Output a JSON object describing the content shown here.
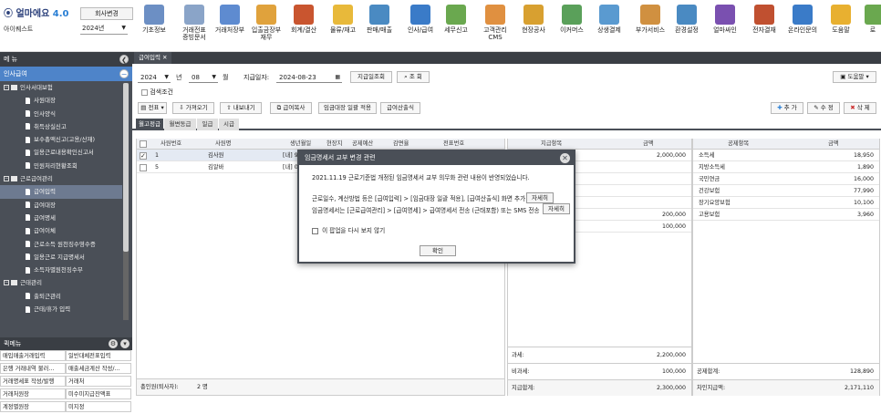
{
  "app": {
    "logo": "얼마에요",
    "version": "4.0",
    "company": "아이퀘스트",
    "switch_label": "회사변경",
    "year": "2024년"
  },
  "top_menu": [
    {
      "label": "기초정보",
      "icon": "document-icon",
      "color": "#6c8fc4"
    },
    {
      "label": "거래전표",
      "label2": "증빙문서",
      "icon": "ledger-icon",
      "color": "#8aa4c8"
    },
    {
      "label": "거래처장부",
      "icon": "book-icon",
      "color": "#5e8bd0"
    },
    {
      "label": "입출금장부",
      "label2": "재무",
      "icon": "house-icon",
      "color": "#e0a23c"
    },
    {
      "label": "회계/결산",
      "icon": "calc-icon",
      "color": "#c9552f"
    },
    {
      "label": "물류/재고",
      "icon": "truck-icon",
      "color": "#e8b93a"
    },
    {
      "label": "판매/매출",
      "icon": "cart-icon",
      "color": "#4a8ac2"
    },
    {
      "label": "인사/급여",
      "icon": "person-icon",
      "color": "#3a7bc8"
    },
    {
      "label": "세무신고",
      "icon": "tax-icon",
      "color": "#6aa84f"
    },
    {
      "label": "고객관리",
      "label2": "CMS",
      "icon": "people-icon",
      "color": "#e09040"
    },
    {
      "label": "현장공사",
      "icon": "construction-icon",
      "color": "#d8a030"
    },
    {
      "label": "이커머스",
      "icon": "shop-icon",
      "color": "#5aa05a"
    },
    {
      "label": "상생결제",
      "icon": "card-icon",
      "color": "#5a9ad0"
    },
    {
      "label": "부가서비스",
      "icon": "bank-icon",
      "color": "#d09040"
    },
    {
      "label": "환경설정",
      "icon": "gear-icon",
      "color": "#4a8ac2"
    },
    {
      "label": "얼마싸인",
      "icon": "sign-icon",
      "color": "#7a50b0"
    },
    {
      "label": "전자결재",
      "icon": "approval-icon",
      "color": "#c05030"
    },
    {
      "label": "온라인문의",
      "icon": "chat-icon",
      "color": "#3a7bc8"
    },
    {
      "label": "도움말",
      "icon": "help-icon",
      "color": "#e8b030"
    },
    {
      "label": "로",
      "icon": "logout-icon",
      "color": "#6aa84f"
    }
  ],
  "sidebar": {
    "header": "메 뉴",
    "section": "인사급여",
    "tree": [
      {
        "label": "인사서대보험",
        "type": "folder"
      },
      {
        "label": "사원대장",
        "type": "leaf"
      },
      {
        "label": "인사양식",
        "type": "leaf"
      },
      {
        "label": "취득상실신고",
        "type": "leaf"
      },
      {
        "label": "보수총액신고(고용/산재)",
        "type": "leaf"
      },
      {
        "label": "일용근로내용확인신고서",
        "type": "leaf"
      },
      {
        "label": "민원처리현황조회",
        "type": "leaf"
      },
      {
        "label": "근로급여관리",
        "type": "folder"
      },
      {
        "label": "급여입력",
        "type": "leaf",
        "selected": true
      },
      {
        "label": "급여대장",
        "type": "leaf"
      },
      {
        "label": "급여명세",
        "type": "leaf"
      },
      {
        "label": "급여이체",
        "type": "leaf"
      },
      {
        "label": "근로소득 원천징수영수증",
        "type": "leaf"
      },
      {
        "label": "일용근로 지급명세서",
        "type": "leaf"
      },
      {
        "label": "소득자별원천징수부",
        "type": "leaf"
      },
      {
        "label": "근태관리",
        "type": "folder"
      },
      {
        "label": "출퇴근관리",
        "type": "leaf"
      },
      {
        "label": "근태/휴가 입력",
        "type": "leaf"
      }
    ],
    "fav_header": "퀵메뉴",
    "favorites": [
      "매입매출거래입력",
      "일반대체전표입력",
      "은행 거래내역 불러...",
      "매출세금계산 작성/...",
      "거래명세표 작성/발행",
      "거래처",
      "거래처원장",
      "미수미지급잔액표",
      "계정별원장",
      "미지정"
    ]
  },
  "main": {
    "tab": "급여입력",
    "year": "2024",
    "year_unit": "년",
    "month": "08",
    "month_unit": "월",
    "pay_date_label": "지급일자:",
    "pay_date": "2024-08-23",
    "pay_date_query": "지급일조회",
    "search": "조 회",
    "help": "도움말",
    "search_condition": "검색조건",
    "toolbar": {
      "slip": "전표",
      "import": "가져오기",
      "export": "내보내기",
      "copy": "급여복사",
      "apply_ledger": "임금대장 일괄 적용",
      "calc": "급여산출식",
      "add": "추 가",
      "edit": "수 정",
      "delete": "삭 제"
    },
    "subtabs": [
      "월고정급",
      "월변동급",
      "일급",
      "시급"
    ],
    "left_columns": [
      "사원번호",
      "사원명",
      "생년월일",
      "현장지",
      "공제예산",
      "감면율",
      "전표번호"
    ],
    "employees": [
      {
        "no": "1",
        "name": "김사원",
        "info": "[내] 93",
        "checked": true
      },
      {
        "no": "5",
        "name": "김알바",
        "info": "[내] 00",
        "checked": false
      }
    ],
    "pay_columns": [
      "지급항목",
      "금액"
    ],
    "pay_items": [
      {
        "name": "",
        "amount": "2,000,000"
      },
      {
        "name": "",
        "amount": ""
      },
      {
        "name": "",
        "amount": ""
      },
      {
        "name": "",
        "amount": ""
      },
      {
        "name": "",
        "amount": ""
      },
      {
        "name": "",
        "amount": "200,000"
      },
      {
        "name": "",
        "amount": "100,000"
      }
    ],
    "deduct_columns": [
      "공제항목",
      "금액"
    ],
    "deduct_items": [
      {
        "name": "소득세",
        "amount": "18,950"
      },
      {
        "name": "지방소득세",
        "amount": "1,890"
      },
      {
        "name": "국민연금",
        "amount": "16,000"
      },
      {
        "name": "건강보험",
        "amount": "77,990"
      },
      {
        "name": "장기요양보험",
        "amount": "10,100"
      },
      {
        "name": "고용보험",
        "amount": "3,960"
      }
    ],
    "totals": {
      "count_label": "총인원(퇴사자):",
      "count": "2 명",
      "taxable_label": "과세:",
      "taxable": "2,200,000",
      "nontax_label": "비과세:",
      "nontax": "100,000",
      "pay_total_label": "지급합계:",
      "pay_total": "2,300,000",
      "deduct_label": "공제합계:",
      "deduct_total": "128,890",
      "net_label": "차인지급액:",
      "net_total": "2,171,110"
    }
  },
  "modal": {
    "title": "임금명세서 교부 변경 관련",
    "line1": "2021.11.19 근로기준법 개정된 임금명세서 교부 의무화 관련 내용이 반영되었습니다.",
    "line2": "근로일수, 계산방법 등은 [급여입력] > [임금대장 일괄 적용], [급여산출식] 화면 추가",
    "line3": "임금명세서는 [근로급여관리] > [급여명세] > 급여명세서 전송 (근태포함) 또는 SMS 전송",
    "detail": "자세히",
    "hide_label": "이 팝업을 다시 보지 않기",
    "confirm": "확인"
  }
}
